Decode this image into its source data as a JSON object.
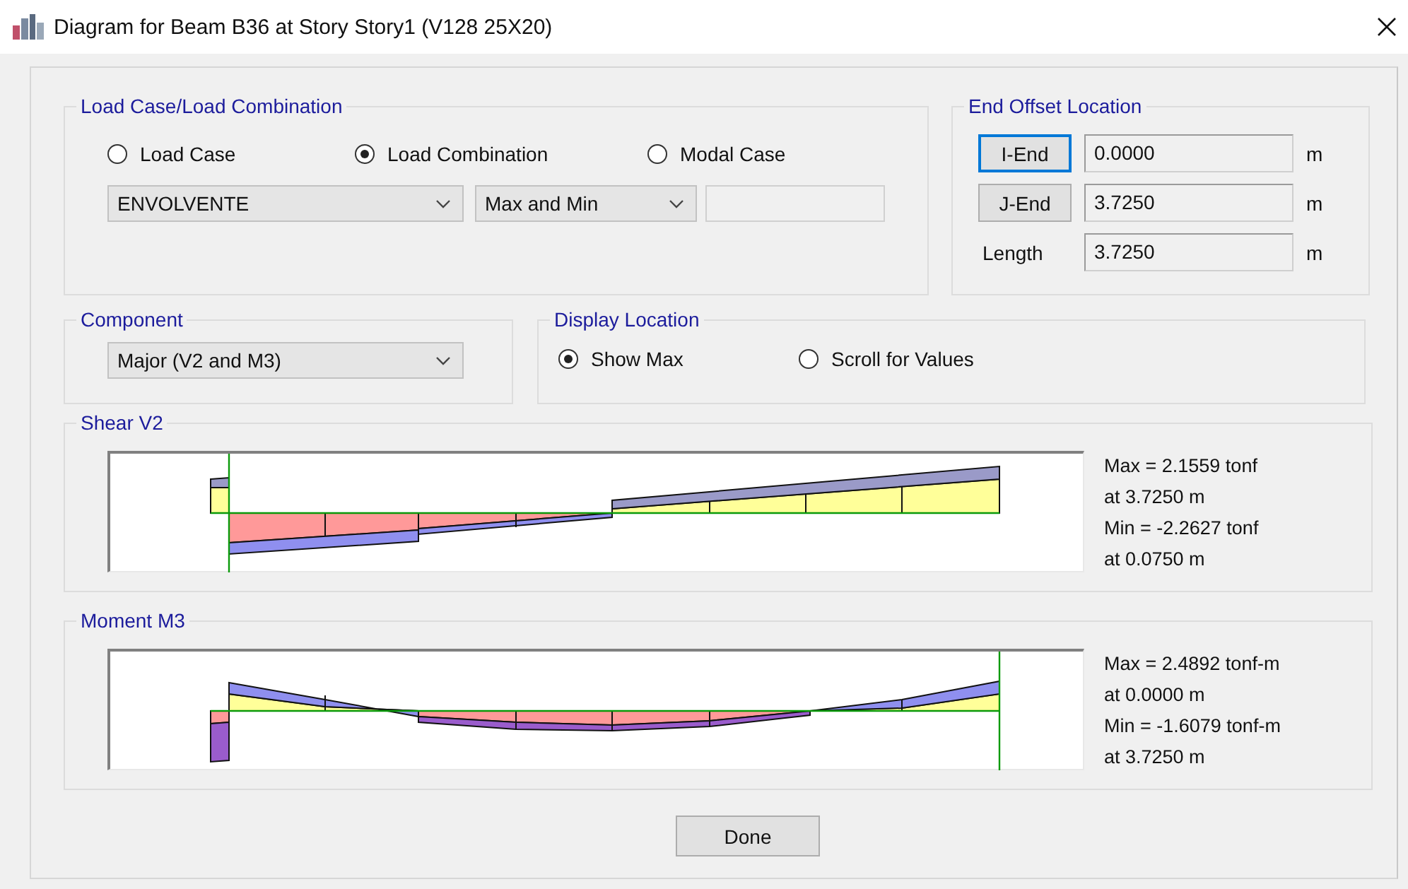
{
  "window": {
    "title": "Diagram for Beam B36 at Story Story1 (V128 25X20)"
  },
  "load_case": {
    "legend": "Load Case/Load Combination",
    "radios": [
      {
        "label": "Load Case",
        "selected": false
      },
      {
        "label": "Load Combination",
        "selected": true
      },
      {
        "label": "Modal Case",
        "selected": false
      }
    ],
    "case_select": "ENVOLVENTE",
    "result_select": "Max and Min"
  },
  "end_offset": {
    "legend": "End Offset Location",
    "rows": [
      {
        "kind": "button",
        "label": "I-End",
        "focused": true,
        "value": "0.0000",
        "unit": "m"
      },
      {
        "kind": "button",
        "label": "J-End",
        "focused": false,
        "value": "3.7250",
        "unit": "m"
      },
      {
        "kind": "label",
        "label": "Length",
        "value": "3.7250",
        "unit": "m"
      }
    ]
  },
  "component": {
    "legend": "Component",
    "select": "Major (V2 and M3)"
  },
  "display_location": {
    "legend": "Display Location",
    "radios": [
      {
        "label": "Show Max",
        "selected": true
      },
      {
        "label": "Scroll for Values",
        "selected": false
      }
    ]
  },
  "diagrams": [
    {
      "kind": "shear",
      "legend": "Shear V2",
      "readouts": [
        "Max = 2.1559 tonf",
        "at 3.7250 m",
        "Min = -2.2627 tonf",
        "at 0.0750 m"
      ]
    },
    {
      "kind": "moment",
      "legend": "Moment M3",
      "readouts": [
        "Max = 2.4892 tonf-m",
        "at 0.0000 m",
        "Min = -1.6079 tonf-m",
        "at 3.7250 m"
      ]
    }
  ],
  "done_button": "Done"
}
